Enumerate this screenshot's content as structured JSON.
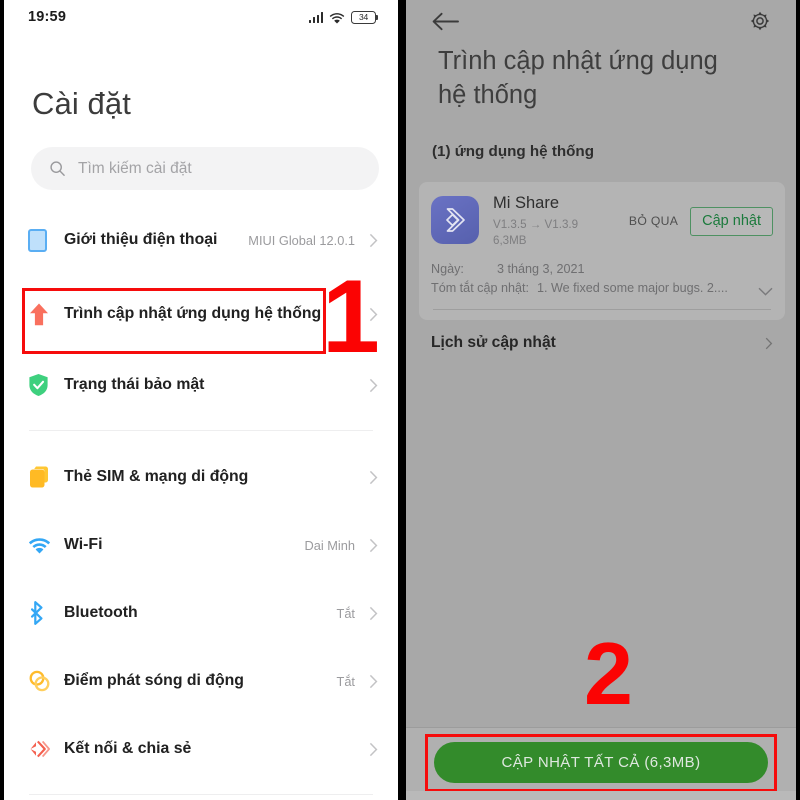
{
  "left_phone": {
    "status_bar": {
      "time": "19:59",
      "signal_icon": "signal-bars-icon",
      "wifi_icon": "wifi-icon",
      "battery_icon": "battery-icon",
      "battery_level": "34"
    },
    "page_title": "Cài đặt",
    "search": {
      "icon": "search-icon",
      "placeholder": "Tìm kiếm cài đặt",
      "value": ""
    },
    "items": [
      {
        "icon": "phone-info-icon",
        "label": "Giới thiệu điện thoại",
        "value": "MIUI Global 12.0.1",
        "chevron": "chevron-right-icon"
      },
      {
        "icon": "system-updater-arrow-icon",
        "label": "Trình cập nhật ứng dụng hệ thống",
        "value": "",
        "chevron": "chevron-right-icon"
      },
      {
        "icon": "security-shield-icon",
        "label": "Trạng thái bảo mật",
        "value": "",
        "chevron": "chevron-right-icon"
      },
      {
        "icon": "sim-card-icon",
        "label": "Thẻ SIM & mạng di động",
        "value": "",
        "chevron": "chevron-right-icon"
      },
      {
        "icon": "wifi-icon",
        "label": "Wi-Fi",
        "value": "Dai Minh",
        "chevron": "chevron-right-icon"
      },
      {
        "icon": "bluetooth-icon",
        "label": "Bluetooth",
        "value": "Tắt",
        "chevron": "chevron-right-icon"
      },
      {
        "icon": "hotspot-icon",
        "label": "Điểm phát sóng di động",
        "value": "Tắt",
        "chevron": "chevron-right-icon"
      },
      {
        "icon": "connection-share-icon",
        "label": "Kết nối & chia sẻ",
        "value": "",
        "chevron": "chevron-right-icon"
      }
    ]
  },
  "right_phone": {
    "top_bar": {
      "back_icon": "back-arrow-icon",
      "settings_icon": "gear-icon"
    },
    "title": "Trình cập nhật ứng dụng hệ thống",
    "section_header": "(1) ứng dụng hệ thống",
    "app": {
      "icon": "mi-share-app-icon",
      "name": "Mi Share",
      "version": "V1.3.5 → V1.3.9",
      "size": "6,3MB",
      "skip_label": "BỎ QUA",
      "update_label": "Cập nhật",
      "date_key": "Ngày:",
      "date_value": "3 tháng 3, 2021",
      "summary_key": "Tóm tắt cập nhật:",
      "summary_value": "1. We fixed some major bugs.  2....",
      "expand_icon": "chevron-down-icon"
    },
    "history_row": {
      "label": "Lịch sử cập nhật",
      "chevron": "chevron-right-icon"
    },
    "update_all_button": "CẬP NHẬT TẤT CẢ (6,3MB)"
  },
  "annotations": {
    "step1": "1",
    "step2": "2",
    "highlight_color": "#f60c0c"
  }
}
